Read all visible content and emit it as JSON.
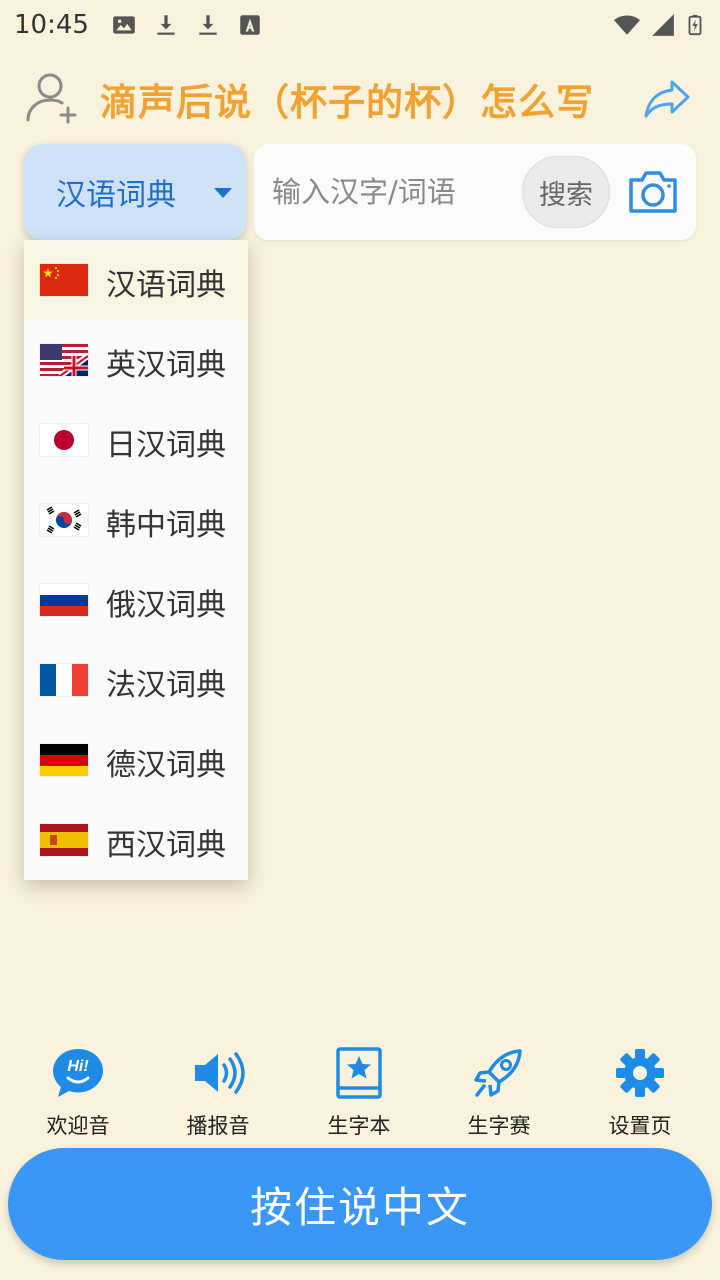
{
  "status_bar": {
    "time": "10:45",
    "icons_left": [
      "image-icon",
      "download-icon",
      "download-icon",
      "font-a-icon"
    ],
    "icons_right": [
      "wifi-icon",
      "signal-icon",
      "battery-icon"
    ]
  },
  "header": {
    "title": "滴声后说（杯子的杯）怎么写",
    "title_color": "#f0a233",
    "user_icon": "add-user-icon",
    "share_icon": "share-arrow-icon"
  },
  "dict_select": {
    "selected": "汉语词典",
    "accent": "#1e6fd1"
  },
  "search": {
    "placeholder": "输入汉字/词语",
    "value": "",
    "button_label": "搜索",
    "camera_icon": "camera-icon"
  },
  "dropdown": {
    "items": [
      {
        "label": "汉语词典",
        "flag": "china-flag-icon",
        "selected": true
      },
      {
        "label": "英汉词典",
        "flag": "usa-uk-flag-icon",
        "selected": false
      },
      {
        "label": "日汉词典",
        "flag": "japan-flag-icon",
        "selected": false
      },
      {
        "label": "韩中词典",
        "flag": "korea-flag-icon",
        "selected": false
      },
      {
        "label": "俄汉词典",
        "flag": "russia-flag-icon",
        "selected": false
      },
      {
        "label": "法汉词典",
        "flag": "france-flag-icon",
        "selected": false
      },
      {
        "label": "德汉词典",
        "flag": "germany-flag-icon",
        "selected": false
      },
      {
        "label": "西汉词典",
        "flag": "spain-flag-icon",
        "selected": false
      }
    ]
  },
  "bottom_nav": {
    "items": [
      {
        "label": "欢迎音",
        "icon": "hi-chat-icon"
      },
      {
        "label": "播报音",
        "icon": "speaker-icon"
      },
      {
        "label": "生字本",
        "icon": "star-book-icon"
      },
      {
        "label": "生字赛",
        "icon": "rocket-icon"
      },
      {
        "label": "设置页",
        "icon": "gear-icon"
      }
    ],
    "icon_color": "#1f8be6"
  },
  "talk_button": {
    "label": "按住说中文",
    "color": "#3a97f5"
  }
}
